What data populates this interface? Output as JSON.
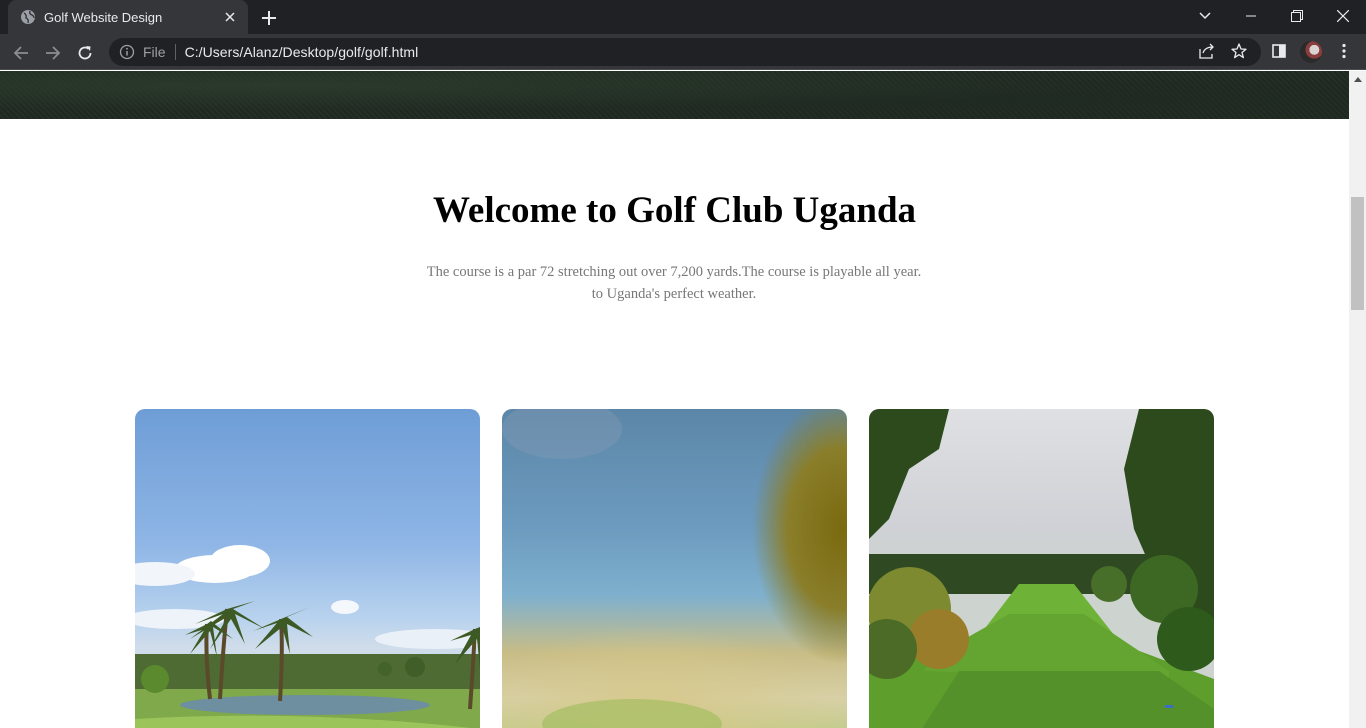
{
  "browser": {
    "tab": {
      "title": "Golf Website Design"
    },
    "address": {
      "scheme": "File",
      "url": "C:/Users/Alanz/Desktop/golf/golf.html"
    }
  },
  "page": {
    "welcome": {
      "title": "Welcome to Golf Club Uganda",
      "text_line1": "The course is a par 72 stretching out over 7,200 yards.The course is playable all year.",
      "text_line2": "to Uganda's perfect weather."
    },
    "cards": [
      {
        "subject": "palm trees golf course with pond"
      },
      {
        "subject": "blurred golf course scene"
      },
      {
        "subject": "tree-lined fairway"
      }
    ]
  },
  "colors": {
    "chrome_dark": "#202124",
    "chrome_toolbar": "#35363a",
    "text_muted": "#777777"
  }
}
